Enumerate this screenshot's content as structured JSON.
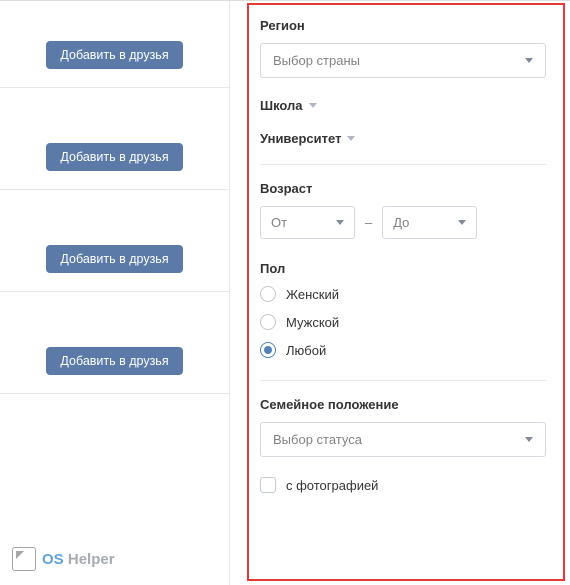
{
  "left": {
    "add_label": "Добавить в друзья"
  },
  "filters": {
    "region": {
      "label": "Регион",
      "placeholder": "Выбор страны"
    },
    "school": {
      "label": "Школа"
    },
    "university": {
      "label": "Университет"
    },
    "age": {
      "label": "Возраст",
      "from_placeholder": "От",
      "to_placeholder": "До"
    },
    "gender": {
      "label": "Пол",
      "options": [
        {
          "label": "Женский",
          "checked": false
        },
        {
          "label": "Мужской",
          "checked": false
        },
        {
          "label": "Любой",
          "checked": true
        }
      ]
    },
    "marital": {
      "label": "Семейное положение",
      "placeholder": "Выбор статуса"
    },
    "with_photo": {
      "label": "с фотографией",
      "checked": false
    }
  },
  "watermark": {
    "os": "OS",
    "helper": "Helper"
  }
}
